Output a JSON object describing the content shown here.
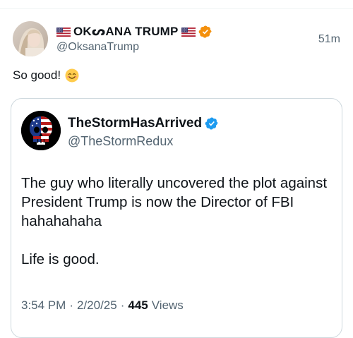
{
  "post": {
    "display_name": "OKᔕANA TRUMP",
    "handle": "@OksanaTrump",
    "time_ago": "51m",
    "text": "So good!",
    "emoji_icon": "smiling-face-icon"
  },
  "quoted": {
    "display_name": "TheStormHasArrived",
    "handle": "@TheStormRedux",
    "body_line_1": "The guy who literally uncovered the plot against President Trump is now the Director of FBI hahahahaha",
    "body_line_2": "Life is good.",
    "time": "3:54 PM",
    "date": "2/20/25",
    "separator": "·",
    "views_count": "445",
    "views_label": "Views"
  },
  "colors": {
    "verified_orange": "#f4900c",
    "verified_blue": "#1d9bf0",
    "secondary_text": "#536471",
    "border": "#cfd9de"
  }
}
